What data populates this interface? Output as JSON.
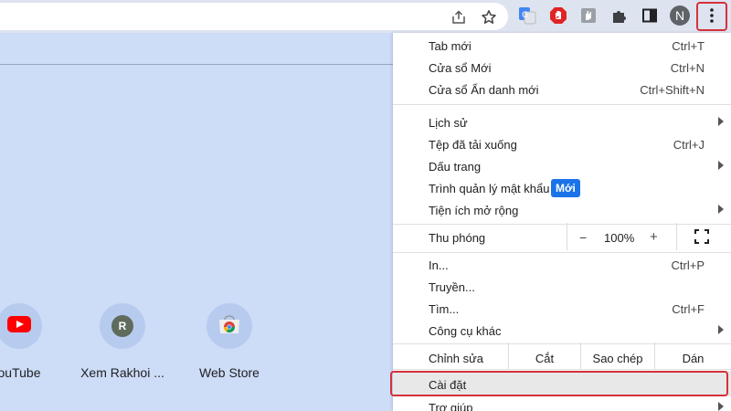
{
  "menu": {
    "items": [
      {
        "label": "Tab mới",
        "shortcut": "Ctrl+T"
      },
      {
        "label": "Cửa sổ Mới",
        "shortcut": "Ctrl+N"
      },
      {
        "label": "Cửa sổ Ẩn danh mới",
        "shortcut": "Ctrl+Shift+N"
      },
      {
        "label": "Lịch sử"
      },
      {
        "label": "Tệp đã tải xuống",
        "shortcut": "Ctrl+J"
      },
      {
        "label": "Dấu trang"
      },
      {
        "label": "Trình quản lý mật khẩu",
        "badge": "Mới"
      },
      {
        "label": "Tiện ích mở rộng"
      },
      {
        "label": "In...",
        "shortcut": "Ctrl+P"
      },
      {
        "label": "Truyền..."
      },
      {
        "label": "Tìm...",
        "shortcut": "Ctrl+F"
      },
      {
        "label": "Công cụ khác"
      },
      {
        "label": "Cài đặt"
      },
      {
        "label": "Trợ giúp"
      }
    ],
    "zoom": {
      "label": "Thu phóng",
      "minus": "−",
      "value": "100%",
      "plus": "+"
    },
    "edit": {
      "label": "Chỉnh sửa",
      "cut": "Cắt",
      "copy": "Sao chép",
      "paste": "Dán"
    }
  },
  "shortcuts": [
    {
      "title": "ouTube",
      "icon": "youtube-icon"
    },
    {
      "title": "Xem Rakhoi ...",
      "initial": "R",
      "icon": "letter-avatar-icon"
    },
    {
      "title": "Web Store",
      "icon": "chrome-web-store-icon"
    }
  ],
  "profile": {
    "initial": "N"
  },
  "colors": {
    "highlight": "#d4313b",
    "badge": "#1a73e8",
    "background": "#cddcf7"
  }
}
